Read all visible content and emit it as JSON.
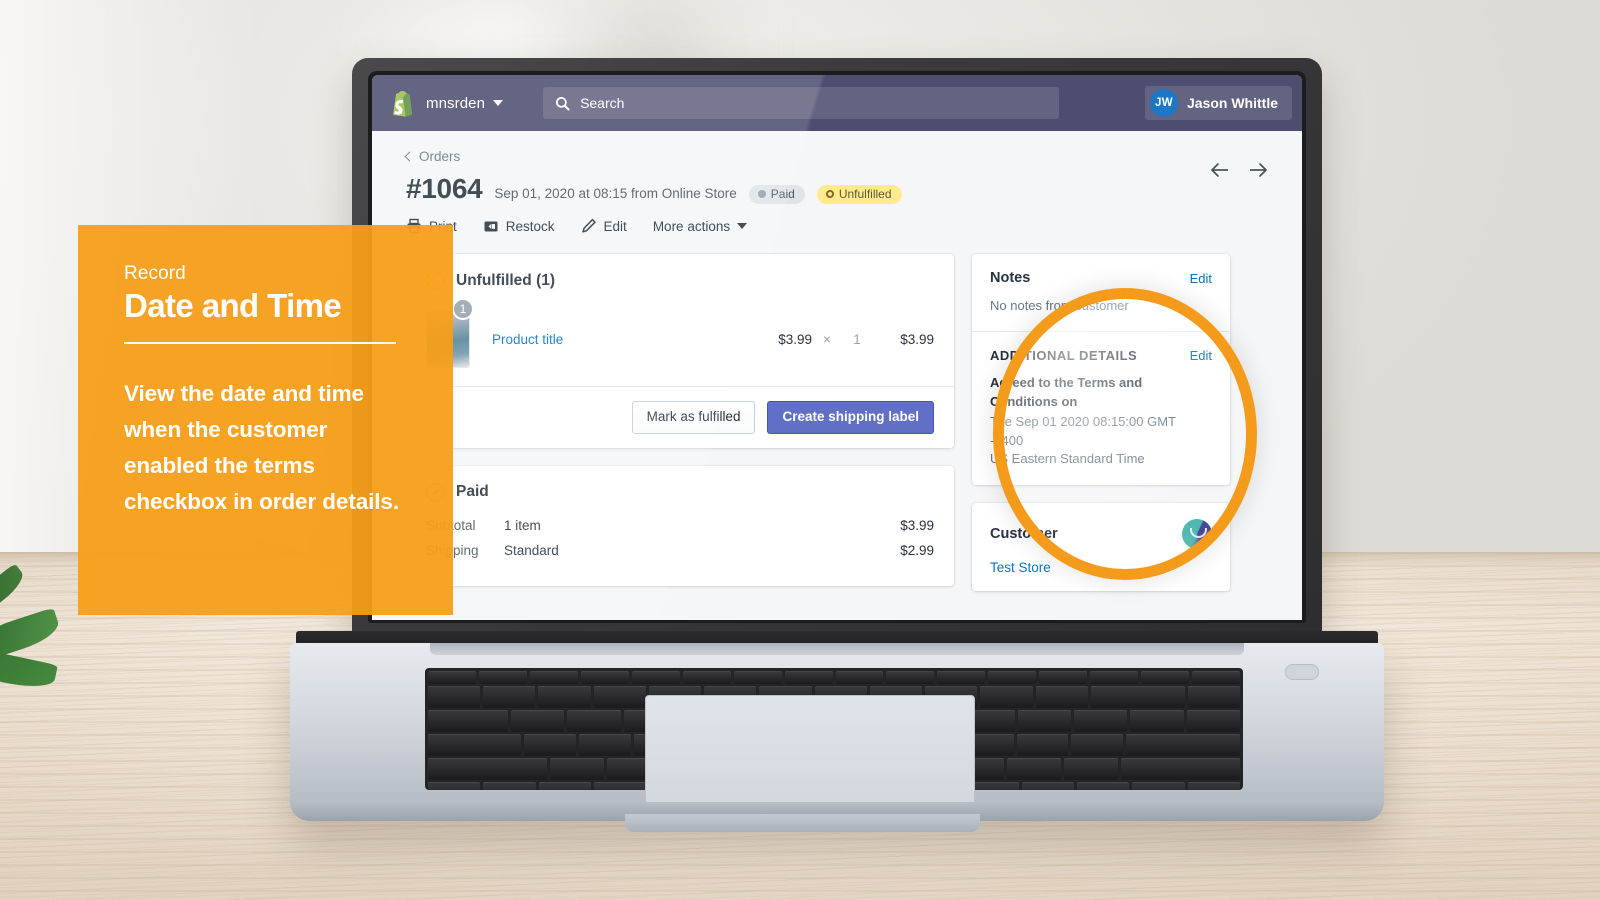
{
  "topbar": {
    "store_name": "mnsrden",
    "store_caret": "chevron-down",
    "search_placeholder": "Search",
    "user_initials": "JW",
    "user_name": "Jason Whittle",
    "bar_color": "#47476b",
    "avatar_color": "#1472c4"
  },
  "page": {
    "breadcrumb": "Orders",
    "order_number": "#1064",
    "order_meta": "Sep 01, 2020 at 08:15 from Online Store",
    "badges": [
      {
        "label": "Paid",
        "style": "paid"
      },
      {
        "label": "Unfulfilled",
        "style": "unfulfilled"
      }
    ],
    "actions": [
      {
        "label": "Print",
        "icon": "printer-icon"
      },
      {
        "label": "Restock",
        "icon": "restock-icon"
      },
      {
        "label": "Edit",
        "icon": "pencil-icon"
      },
      {
        "label": "More actions",
        "icon": "chevron-down-icon"
      }
    ],
    "nav_prev": "←",
    "nav_next": "→"
  },
  "unfulfilled_card": {
    "title": "Unfulfilled (1)",
    "status_icon": "dashed-circle-icon",
    "item": {
      "quantity_badge": "1",
      "product_title": "Product title",
      "unit_price": "$3.99",
      "multiplier": "×",
      "quantity": "1",
      "line_total": "$3.99"
    },
    "buttons": [
      {
        "label": "Mark as fulfilled",
        "style": "default"
      },
      {
        "label": "Create shipping label",
        "style": "primary"
      }
    ]
  },
  "paid_card": {
    "title": "Paid",
    "status_icon": "check-circle-icon",
    "rows": [
      {
        "label": "Subtotal",
        "detail": "1 item",
        "amount": "$3.99"
      },
      {
        "label": "Shipping",
        "detail": "Standard",
        "amount": "$2.99"
      }
    ]
  },
  "sidebar": {
    "notes": {
      "heading": "Notes",
      "edit_label": "Edit",
      "body": "No notes from customer"
    },
    "additional_details": {
      "heading": "ADDITIONAL DETAILS",
      "edit_label": "Edit",
      "field_label": "Agreed to the Terms and Conditions on",
      "value_line1": "Tue Sep 01 2020 08:15:00 GMT -0400",
      "value_line2": "US Eastern Standard Time"
    },
    "customer": {
      "heading": "Customer",
      "name": "Test Store",
      "avatar_icon": "customer-avatar-icon"
    }
  },
  "callout": {
    "kicker": "Record",
    "title": "Date and Time",
    "body": "View the date and time when the customer enabled the terms checkbox in order details.",
    "background_color": "#f59b1c"
  },
  "magnifier": {
    "ring_color": "#f59b1c",
    "shape": "circle-highlight"
  }
}
